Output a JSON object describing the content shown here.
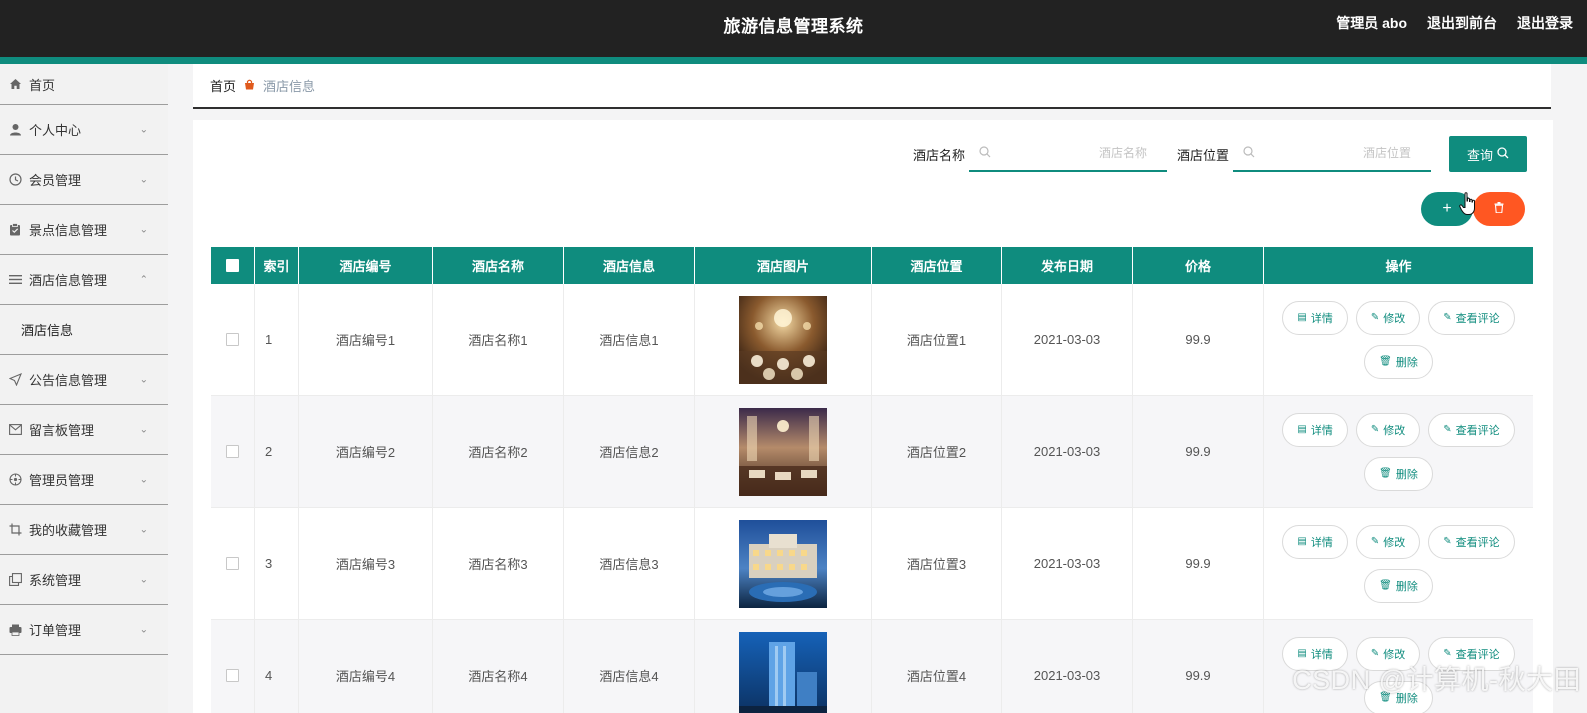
{
  "header": {
    "title": "旅游信息管理系统",
    "user_label": "管理员 abo",
    "to_front": "退出到前台",
    "logout": "退出登录"
  },
  "sidebar": {
    "items": [
      {
        "label": "首页",
        "icon": "home-icon"
      },
      {
        "label": "个人中心",
        "icon": "user-icon"
      },
      {
        "label": "会员管理",
        "icon": "clock-icon"
      },
      {
        "label": "景点信息管理",
        "icon": "clipboard-icon"
      },
      {
        "label": "酒店信息管理",
        "icon": "list-icon"
      },
      {
        "label": "公告信息管理",
        "icon": "send-icon"
      },
      {
        "label": "留言板管理",
        "icon": "mail-icon"
      },
      {
        "label": "管理员管理",
        "icon": "compass-icon"
      },
      {
        "label": "我的收藏管理",
        "icon": "crop-icon"
      },
      {
        "label": "系统管理",
        "icon": "copy-icon"
      },
      {
        "label": "订单管理",
        "icon": "printer-icon"
      }
    ],
    "submenu": {
      "label": "酒店信息"
    }
  },
  "breadcrumb": {
    "home": "首页",
    "current": "酒店信息"
  },
  "search": {
    "name_label": "酒店名称",
    "name_placeholder": "酒店名称",
    "location_label": "酒店位置",
    "location_placeholder": "酒店位置",
    "query_button": "查询"
  },
  "actions": {
    "add": "+",
    "delete_icon": "trash-icon"
  },
  "table": {
    "headers": [
      "索引",
      "酒店编号",
      "酒店名称",
      "酒店信息",
      "酒店图片",
      "酒店位置",
      "发布日期",
      "价格",
      "操作"
    ],
    "rows": [
      {
        "index": "1",
        "code": "酒店编号1",
        "name": "酒店名称1",
        "info": "酒店信息1",
        "location": "酒店位置1",
        "date": "2021-03-03",
        "price": "99.9"
      },
      {
        "index": "2",
        "code": "酒店编号2",
        "name": "酒店名称2",
        "info": "酒店信息2",
        "location": "酒店位置2",
        "date": "2021-03-03",
        "price": "99.9"
      },
      {
        "index": "3",
        "code": "酒店编号3",
        "name": "酒店名称3",
        "info": "酒店信息3",
        "location": "酒店位置3",
        "date": "2021-03-03",
        "price": "99.9"
      },
      {
        "index": "4",
        "code": "酒店编号4",
        "name": "酒店名称4",
        "info": "酒店信息4",
        "location": "酒店位置4",
        "date": "2021-03-03",
        "price": "99.9"
      }
    ],
    "ops": {
      "detail": "详情",
      "edit": "修改",
      "comments": "查看评论",
      "delete": "删除"
    }
  },
  "watermark": "CSDN @计算机-秋大田",
  "colors": {
    "header_bg": "#222222",
    "accent": "#0f8c7e",
    "danger": "#ff5722"
  }
}
